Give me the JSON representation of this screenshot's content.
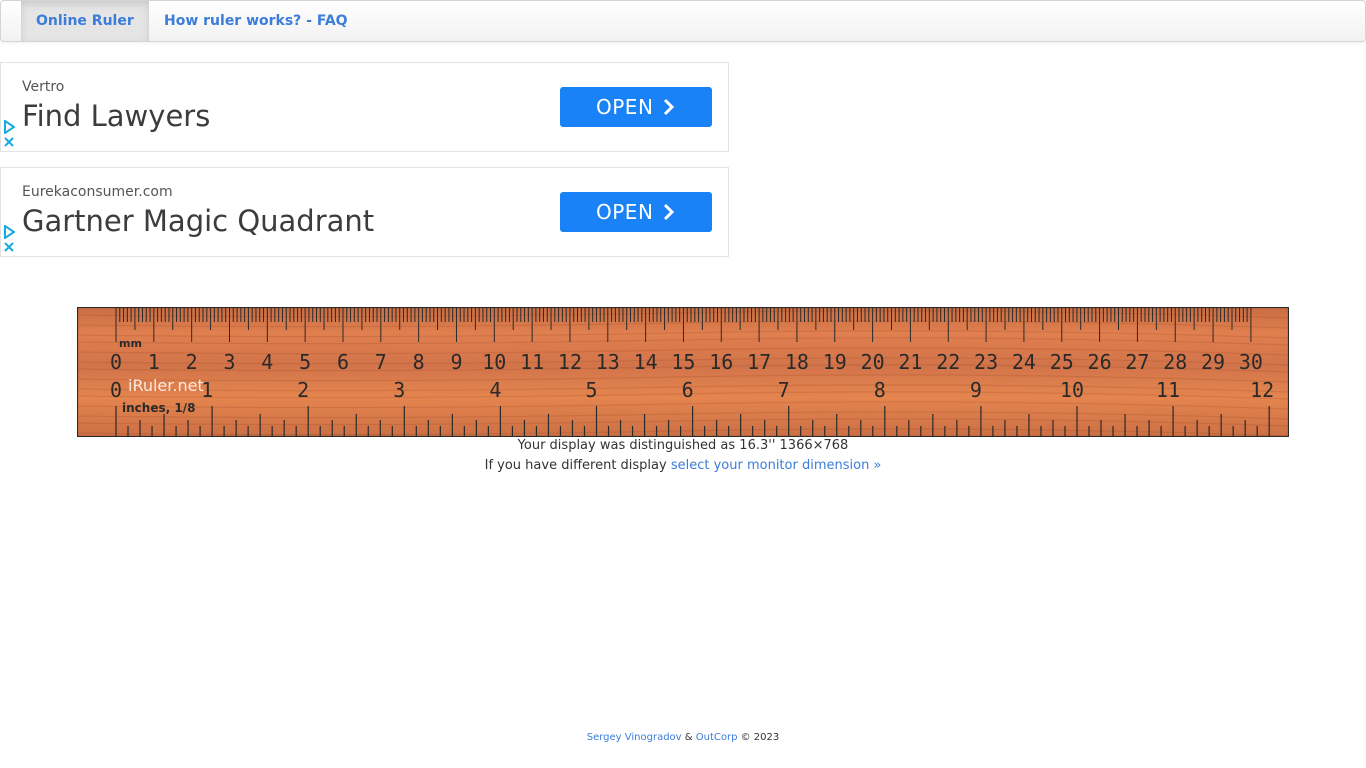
{
  "nav": {
    "items": [
      {
        "label": "Online Ruler",
        "active": true
      },
      {
        "label": "How ruler works? - FAQ",
        "active": false
      }
    ]
  },
  "ads": [
    {
      "source": "Vertro",
      "headline": "Find Lawyers",
      "button": "OPEN"
    },
    {
      "source": "Eurekaconsumer.com",
      "headline": "Gartner Magic Quadrant",
      "button": "OPEN"
    }
  ],
  "ruler": {
    "mm_label": "mm",
    "brand": "iRuler.net",
    "inches_label": "inches, 1/8",
    "cm_max": 30,
    "inch_max": 12,
    "colors": {
      "wood": "#d9784a",
      "ink": "#2a2a2a"
    }
  },
  "display": {
    "line1": "Your display was distinguished as 16.3'' 1366×768",
    "line2_prefix": "If you have different display ",
    "line2_link": "select your monitor dimension »"
  },
  "footer": {
    "author": "Sergey Vinogradov",
    "amp": " & ",
    "company": "OutCorp",
    "copyright": " © 2023"
  }
}
